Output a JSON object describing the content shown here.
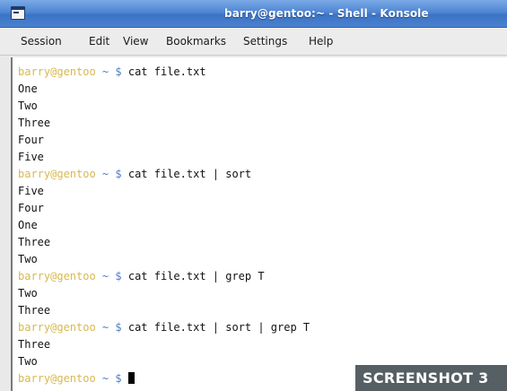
{
  "window": {
    "title": "barry@gentoo:~ - Shell - Konsole"
  },
  "menu": [
    "Session",
    "Edit",
    "View",
    "Bookmarks",
    "Settings",
    "Help"
  ],
  "terminal": {
    "prompt_user": "barry@gentoo",
    "prompt_dir": "~",
    "prompt_symbol": "$",
    "lines": [
      {
        "type": "cmd",
        "text": "cat file.txt"
      },
      {
        "type": "out",
        "text": "One"
      },
      {
        "type": "out",
        "text": "Two"
      },
      {
        "type": "out",
        "text": "Three"
      },
      {
        "type": "out",
        "text": "Four"
      },
      {
        "type": "out",
        "text": "Five"
      },
      {
        "type": "cmd",
        "text": "cat file.txt | sort"
      },
      {
        "type": "out",
        "text": "Five"
      },
      {
        "type": "out",
        "text": "Four"
      },
      {
        "type": "out",
        "text": "One"
      },
      {
        "type": "out",
        "text": "Three"
      },
      {
        "type": "out",
        "text": "Two"
      },
      {
        "type": "cmd",
        "text": "cat file.txt | grep T"
      },
      {
        "type": "out",
        "text": "Two"
      },
      {
        "type": "out",
        "text": "Three"
      },
      {
        "type": "cmd",
        "text": "cat file.txt | sort | grep T"
      },
      {
        "type": "out",
        "text": "Three"
      },
      {
        "type": "out",
        "text": "Two"
      },
      {
        "type": "cmd",
        "text": ""
      }
    ]
  },
  "banner": {
    "text": "SCREENSHOT 3"
  },
  "colors": {
    "titlebar": "#4f86d3",
    "prompt_user": "#d8b84d",
    "prompt_separator": "#4f7cc4",
    "banner": "#566064"
  }
}
